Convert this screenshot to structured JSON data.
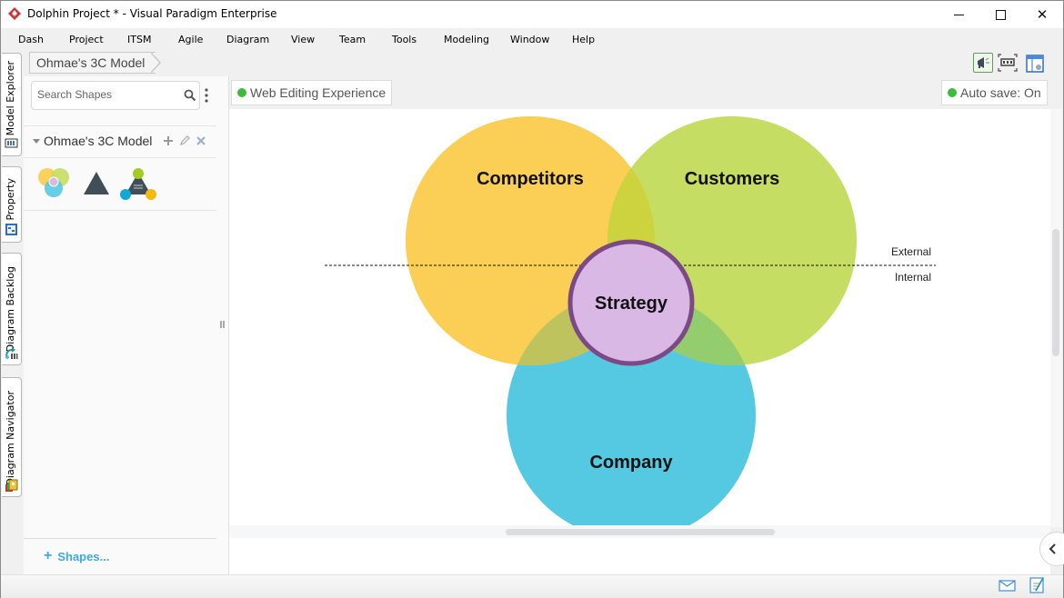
{
  "window": {
    "title": "Dolphin Project * - Visual Paradigm Enterprise",
    "controls": [
      "minimize",
      "maximize",
      "close"
    ]
  },
  "menu": [
    "Dash",
    "Project",
    "ITSM",
    "Agile",
    "Diagram",
    "View",
    "Team",
    "Tools",
    "Modeling",
    "Window",
    "Help"
  ],
  "side_tabs": [
    {
      "label": "Model Explorer",
      "icon": "model-explorer-icon"
    },
    {
      "label": "Property",
      "icon": "property-icon"
    },
    {
      "label": "Diagram Backlog",
      "icon": "diagram-backlog-icon"
    },
    {
      "label": "Diagram Navigator",
      "icon": "diagram-navigator-icon"
    }
  ],
  "breadcrumb": "Ohmae's 3C Model",
  "toolbar_icons": [
    "announcement-icon",
    "fit-diagram-icon",
    "layout-panel-icon"
  ],
  "shape_panel": {
    "search_placeholder": "Search Shapes",
    "search_value": "",
    "category": "Ohmae's 3C Model",
    "category_actions": [
      "add",
      "edit",
      "remove"
    ],
    "shapes": [
      "3c-venn-shape",
      "triangle-shape",
      "triangle-circles-shape"
    ],
    "footer_link": "Shapes..."
  },
  "canvas": {
    "web_editing_label": "Web Editing Experience",
    "autosave_label": "Auto save: On",
    "status_color": "#3dbb3d"
  },
  "diagram": {
    "circles": [
      {
        "label": "Competitors",
        "color": "#fbcf55"
      },
      {
        "label": "Customers",
        "color": "#c5dd62"
      },
      {
        "label": "Company",
        "color": "#55c9e2"
      }
    ],
    "center": {
      "label": "Strategy",
      "fill": "#d9b8e6",
      "stroke": "#7b4a85"
    },
    "divider": {
      "above_label": "External",
      "below_label": "Internal"
    }
  },
  "statusbar_icons": [
    "mail-icon",
    "notes-icon"
  ]
}
